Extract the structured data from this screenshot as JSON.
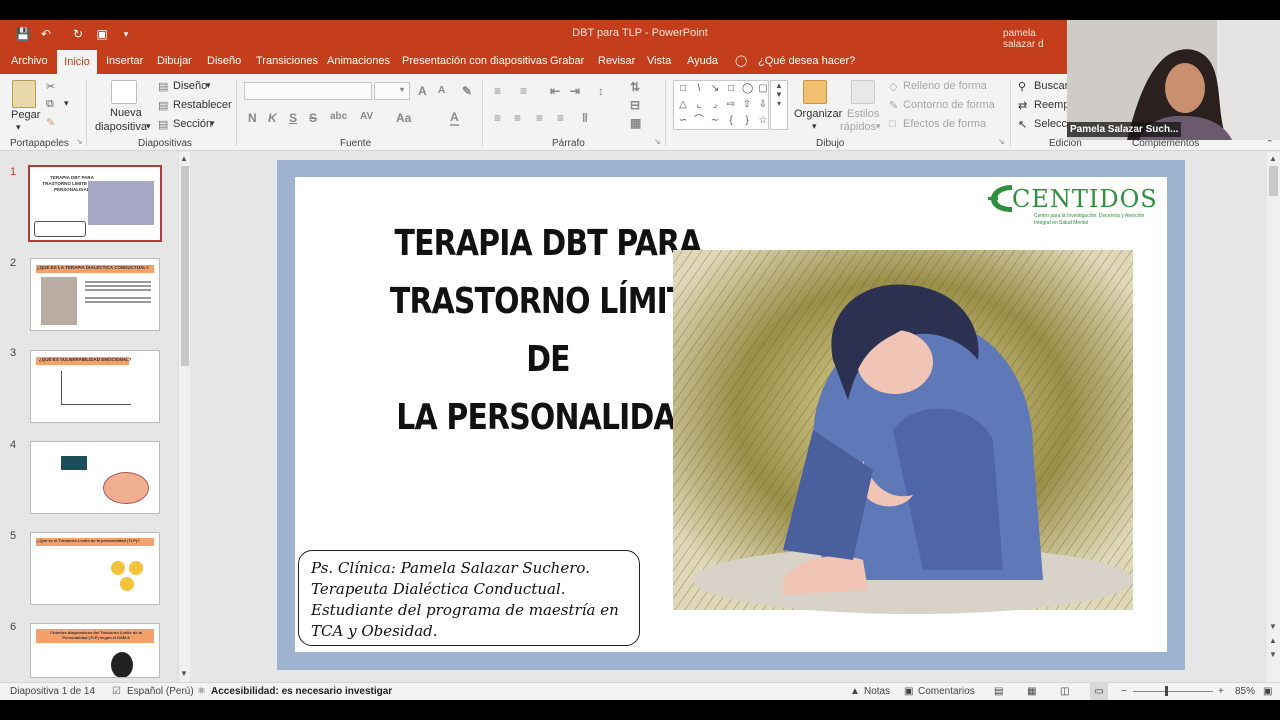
{
  "window": {
    "doc_title": "DBT para TLP  -  PowerPoint",
    "user": "pamela salazar d"
  },
  "tabs": [
    "Archivo",
    "Inicio",
    "Insertar",
    "Dibujar",
    "Diseño",
    "Transiciones",
    "Animaciones",
    "Presentación con diapositivas",
    "Grabar",
    "Revisar",
    "Vista",
    "Ayuda"
  ],
  "tell_me": "¿Qué desea hacer?",
  "ribbon": {
    "paste": "Pegar",
    "new_slide_1": "Nueva",
    "new_slide_2": "diapositiva",
    "layout": "Diseño",
    "reset": "Restablecer",
    "section": "Sección",
    "organize": "Organizar",
    "styles_1": "Estilos",
    "styles_2": "rápidos",
    "fill": "Relleno de forma",
    "outline": "Contorno de forma",
    "effects": "Efectos de forma",
    "find": "Buscar",
    "replace": "Reempl",
    "select": "Selecci",
    "font_n": "N",
    "font_k": "K",
    "font_s": "S",
    "font_abc": "abc",
    "font_av": "AV",
    "font_aa": "Aa",
    "font_grow": "A",
    "groups": {
      "clipboard": "Portapapeles",
      "slides": "Diapositivas",
      "font": "Fuente",
      "paragraph": "Párrafo",
      "drawing": "Dibujo",
      "editing": "Edición",
      "addins": "Complementos"
    }
  },
  "webcam": {
    "name": "Pamela Salazar Such..."
  },
  "thumbnails": [
    {
      "num": "1",
      "title": "TERAPIA DBT PARA TRASTORNO LÍMITE DE LA PERSONALIDAD"
    },
    {
      "num": "2",
      "title": "¿QUÉ ES LA TERAPIA DIALÉCTICA CONDUCTUAL?"
    },
    {
      "num": "3",
      "title": "¿QUÉ ES VULNERABILIDAD EMOCIONAL?"
    },
    {
      "num": "4",
      "title": ""
    },
    {
      "num": "5",
      "title": "¿Qué es el Trastorno Límite de la personalidad (TLP)?"
    },
    {
      "num": "6",
      "title": "Criterios diagnósticos del Trastorno Límite de la Personalidad (TLP) según el DSM-5"
    }
  ],
  "slide": {
    "title_line1": "TERAPIA DBT PARA",
    "title_line2": "TRASTORNO LÍMITE DE",
    "title_line3": "LA PERSONALIDAD",
    "logo": "CENTIDOS",
    "logo_sub": "Centro para la Investigación, Docencia y Atención Integral en Salud Mental",
    "bio_line1": "Ps. Clínica: Pamela Salazar Suchero.",
    "bio_line2": "Terapeuta Dialéctica Conductual.",
    "bio_line3": "Estudiante del programa de maestría en",
    "bio_line4": "TCA y Obesidad."
  },
  "status": {
    "slide_count": "Diapositiva 1 de 14",
    "language": "Español (Perú)",
    "accessibility": "Accesibilidad: es necesario investigar",
    "notes": "Notas",
    "comments": "Comentarios",
    "zoom": "85%"
  },
  "colors": {
    "accent": "#c43e1c",
    "slide_border": "#9db3cf",
    "logo_green": "#2e8f3c"
  }
}
